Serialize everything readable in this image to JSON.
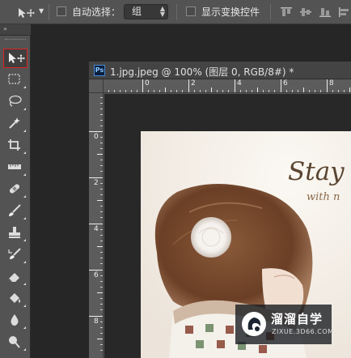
{
  "options_bar": {
    "auto_select_label": "自动选择：",
    "auto_select_checked": false,
    "auto_select_target": "组",
    "show_transform_label": "显示变换控件",
    "show_transform_checked": false
  },
  "toolbox": {
    "collapse_glyph": "»",
    "tools": [
      {
        "name": "move-tool",
        "icon": "move-icon",
        "active": true
      },
      {
        "name": "marquee-tool",
        "icon": "rect-marquee-icon"
      },
      {
        "name": "lasso-tool",
        "icon": "lasso-icon"
      },
      {
        "name": "magic-wand-tool",
        "icon": "magic-wand-icon"
      },
      {
        "name": "crop-tool",
        "icon": "crop-icon"
      },
      {
        "name": "ruler-tool",
        "icon": "ruler-icon"
      },
      {
        "name": "healing-brush-tool",
        "icon": "bandage-icon"
      },
      {
        "name": "brush-tool",
        "icon": "brush-icon"
      },
      {
        "name": "clone-stamp-tool",
        "icon": "stamp-icon"
      },
      {
        "name": "history-brush-tool",
        "icon": "history-brush-icon"
      },
      {
        "name": "eraser-tool",
        "icon": "eraser-icon"
      },
      {
        "name": "paint-bucket-tool",
        "icon": "bucket-icon"
      },
      {
        "name": "blur-tool",
        "icon": "drop-icon"
      },
      {
        "name": "dodge-tool",
        "icon": "dodge-icon"
      },
      {
        "name": "pen-tool",
        "icon": "pen-icon"
      }
    ]
  },
  "document": {
    "app_badge": "Ps",
    "title": "1.jpg.jpeg @ 100% (图层 0, RGB/8#) *",
    "h_ruler": [
      "0",
      "2",
      "4",
      "6",
      "8"
    ],
    "v_ruler": [
      "0",
      "2",
      "4",
      "6",
      "8"
    ]
  },
  "artwork": {
    "headline": "Stay",
    "subline": "with n"
  },
  "watermark": {
    "title": "溜溜自学",
    "subtitle": "ZIXUE.3D66.COM"
  },
  "colors": {
    "panel": "#535353",
    "background": "#262626",
    "highlight": "#dd2222"
  }
}
